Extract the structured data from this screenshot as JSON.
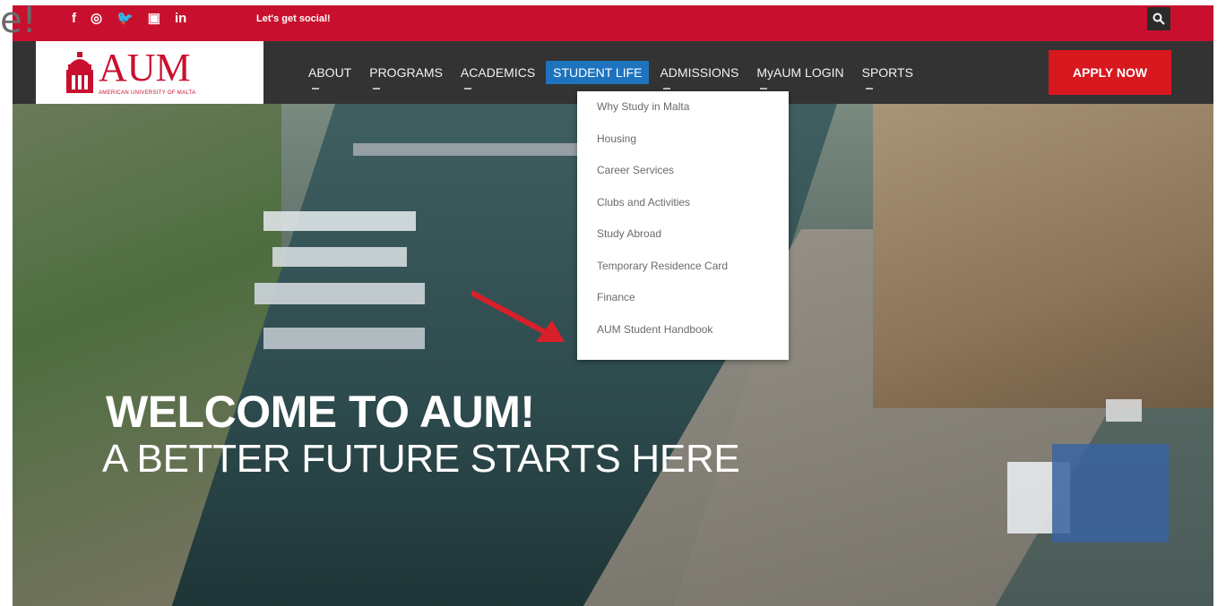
{
  "topbar": {
    "social_icons": [
      "facebook-icon",
      "instagram-icon",
      "twitter-icon",
      "youtube-icon",
      "linkedin-icon"
    ],
    "social_glyphs": [
      "f",
      "◎",
      "🐦",
      "▣",
      "in"
    ],
    "social_text": "Let's get social!",
    "search_glyph": "🔍"
  },
  "header": {
    "logo_text": "AUM",
    "logo_subtext": "AMERICAN UNIVERSITY OF MALTA",
    "nav": [
      {
        "label": "ABOUT"
      },
      {
        "label": "PROGRAMS"
      },
      {
        "label": "ACADEMICS"
      },
      {
        "label": "STUDENT LIFE"
      },
      {
        "label": "ADMISSIONS"
      },
      {
        "label": "MyAUM LOGIN"
      },
      {
        "label": "SPORTS"
      }
    ],
    "active_nav": "STUDENT LIFE",
    "apply_label": "APPLY NOW"
  },
  "dropdown": {
    "items": [
      {
        "label": "Why Study in Malta"
      },
      {
        "label": "Housing"
      },
      {
        "label": "Career Services"
      },
      {
        "label": "Clubs and Activities"
      },
      {
        "label": "Study Abroad"
      },
      {
        "label": "Temporary Residence Card"
      },
      {
        "label": "Finance"
      },
      {
        "label": "AUM Student Handbook"
      }
    ]
  },
  "hero": {
    "title": "WELCOME TO AUM!",
    "subtitle": "A BETTER FUTURE STARTS HERE"
  },
  "corner_overlay": "e!",
  "colors": {
    "brand_red": "#c8102e",
    "nav_bg": "#333333",
    "active_blue": "#1e73be",
    "apply_red": "#d7181f",
    "arrow_red": "#d8202a"
  }
}
